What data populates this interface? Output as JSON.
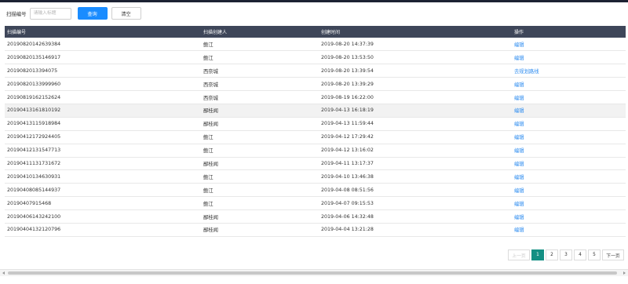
{
  "search": {
    "label": "扫描编号",
    "placeholder": "请输入标题",
    "query_label": "查询",
    "clear_label": "清空"
  },
  "table": {
    "headers": [
      "扫描编号",
      "扫描创建人",
      "创建时间",
      "操作"
    ],
    "rows": [
      {
        "id": "20190820142639384",
        "creator": "鲍江",
        "time": "2019-08-20 14:37:39",
        "action": "编辑"
      },
      {
        "id": "20190820135146917",
        "creator": "鲍江",
        "time": "2019-08-20 13:53:50",
        "action": "编辑"
      },
      {
        "id": "2019082013394075",
        "creator": "西奈城",
        "time": "2019-08-20 13:39:54",
        "action": "去规划路线"
      },
      {
        "id": "20190820133999960",
        "creator": "西奈城",
        "time": "2019-08-20 13:39:29",
        "action": "编辑"
      },
      {
        "id": "20190819162152624",
        "creator": "西奈城",
        "time": "2019-08-19 16:22:00",
        "action": "编辑"
      },
      {
        "id": "20190413161810192",
        "creator": "鄙桂闻",
        "time": "2019-04-13 16:18:19",
        "action": "编辑"
      },
      {
        "id": "20190413115918984",
        "creator": "鄙桂闻",
        "time": "2019-04-13 11:59:44",
        "action": "编辑"
      },
      {
        "id": "20190412172924405",
        "creator": "鲍江",
        "time": "2019-04-12 17:29:42",
        "action": "编辑"
      },
      {
        "id": "20190412131547713",
        "creator": "鲍江",
        "time": "2019-04-12 13:16:02",
        "action": "编辑"
      },
      {
        "id": "20190411131731672",
        "creator": "鄙桂闻",
        "time": "2019-04-11 13:17:37",
        "action": "编辑"
      },
      {
        "id": "20190410134630931",
        "creator": "鲍江",
        "time": "2019-04-10 13:46:38",
        "action": "编辑"
      },
      {
        "id": "20190408085144937",
        "creator": "鲍江",
        "time": "2019-04-08 08:51:56",
        "action": "编辑"
      },
      {
        "id": "2019040791546​8",
        "creator": "鲍江",
        "time": "2019-04-07 09:15:53",
        "action": "编辑"
      },
      {
        "id": "20190406143242100",
        "creator": "鄙桂闻",
        "time": "2019-04-06 14:32:48",
        "action": "编辑"
      },
      {
        "id": "20190404132120796",
        "creator": "鄙桂闻",
        "time": "2019-04-04 13:21:28",
        "action": "编辑"
      }
    ]
  },
  "pagination": {
    "prev_label": "上一页",
    "next_label": "下一页",
    "pages": [
      "1",
      "2",
      "3",
      "4",
      "5"
    ],
    "current": "1"
  },
  "colors": {
    "header_bg": "#3e4659",
    "primary_button": "#1a8cff",
    "active_page": "#138f83",
    "link": "#2d8cf0"
  }
}
